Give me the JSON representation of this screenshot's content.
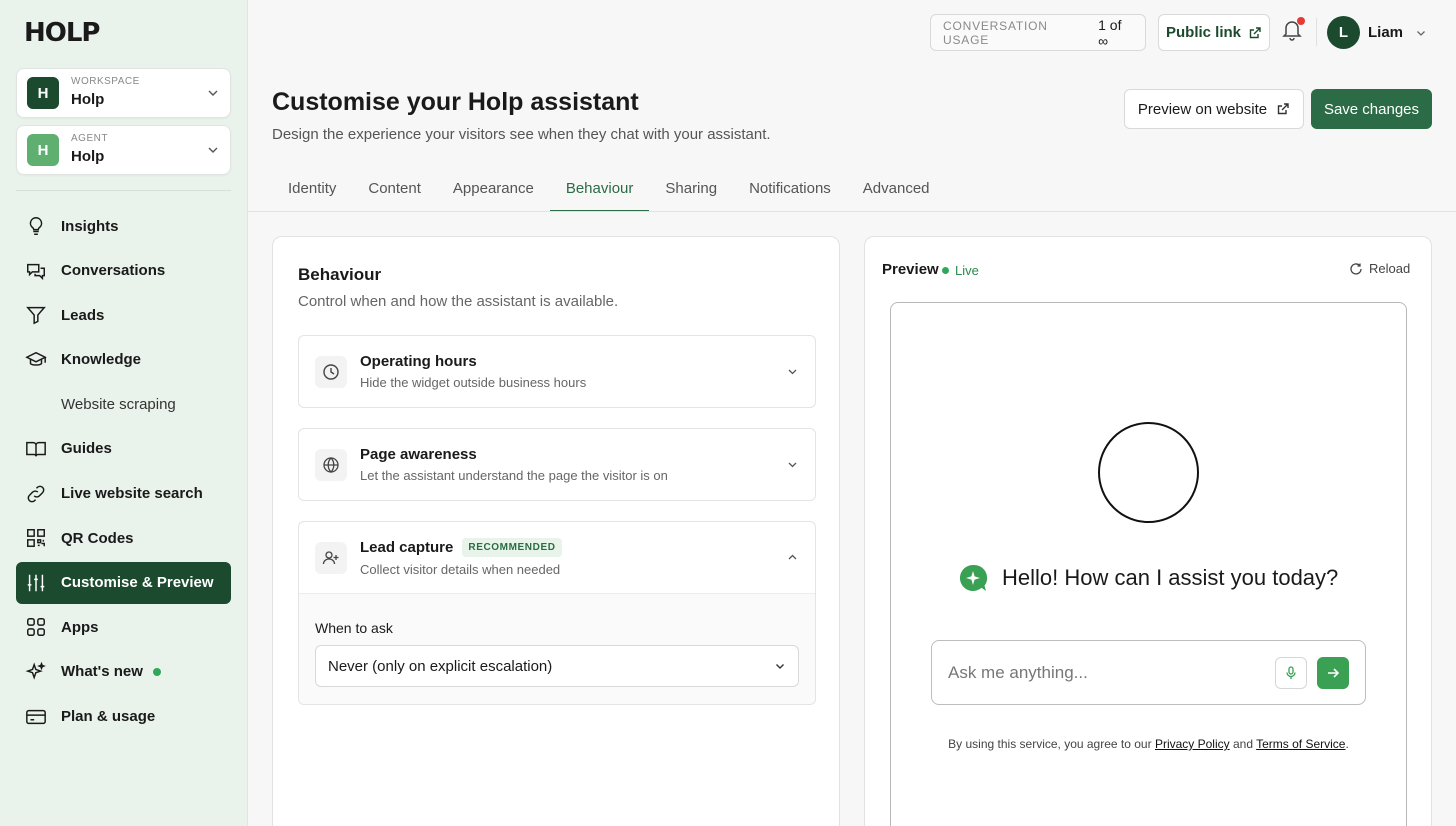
{
  "brand": {
    "logo_text": "HOLP",
    "accent": "#2b6b45",
    "sidebar_bg": "#eaf2ec"
  },
  "workspace": {
    "caption": "WORKSPACE",
    "badge": "H",
    "name": "Holp"
  },
  "agent": {
    "caption": "AGENT",
    "badge": "H",
    "name": "Holp"
  },
  "nav": {
    "insights": "Insights",
    "conversations": "Conversations",
    "leads": "Leads",
    "knowledge": "Knowledge",
    "website_scraping": "Website scraping",
    "guides": "Guides",
    "live_search": "Live website search",
    "qr_codes": "QR Codes",
    "customise": "Customise & Preview",
    "apps": "Apps",
    "whats_new": "What's new",
    "plan_usage": "Plan & usage"
  },
  "topbar": {
    "usage_label": "CONVERSATION USAGE",
    "usage_value": "1 of ∞",
    "public_link": "Public link",
    "user_initial": "L",
    "user_name": "Liam"
  },
  "header": {
    "title": "Customise your Holp assistant",
    "subtitle": "Design the experience your visitors see when they chat with your assistant.",
    "preview_button": "Preview on website",
    "save_button": "Save changes"
  },
  "tabs": [
    "Identity",
    "Content",
    "Appearance",
    "Behaviour",
    "Sharing",
    "Notifications",
    "Advanced"
  ],
  "active_tab": "Behaviour",
  "behaviour": {
    "title": "Behaviour",
    "subtitle": "Control when and how the assistant is available.",
    "sections": [
      {
        "title": "Operating hours",
        "desc": "Hide the widget outside business hours",
        "icon": "clock-icon"
      },
      {
        "title": "Page awareness",
        "desc": "Let the assistant understand the page the visitor is on",
        "icon": "globe-icon"
      },
      {
        "title": "Lead capture",
        "badge": "RECOMMENDED",
        "desc": "Collect visitor details when needed",
        "icon": "user-plus-icon"
      }
    ],
    "lead_capture": {
      "field_label": "When to ask",
      "selected": "Never (only on explicit escalation)"
    }
  },
  "preview": {
    "title": "Preview",
    "status": "Live",
    "reload": "Reload",
    "greeting": "Hello! How can I assist you today?",
    "input_placeholder": "Ask me anything...",
    "legal_prefix": "By using this service, you agree to our",
    "privacy": "Privacy Policy",
    "and": "and",
    "terms": "Terms of Service",
    "period": "."
  }
}
